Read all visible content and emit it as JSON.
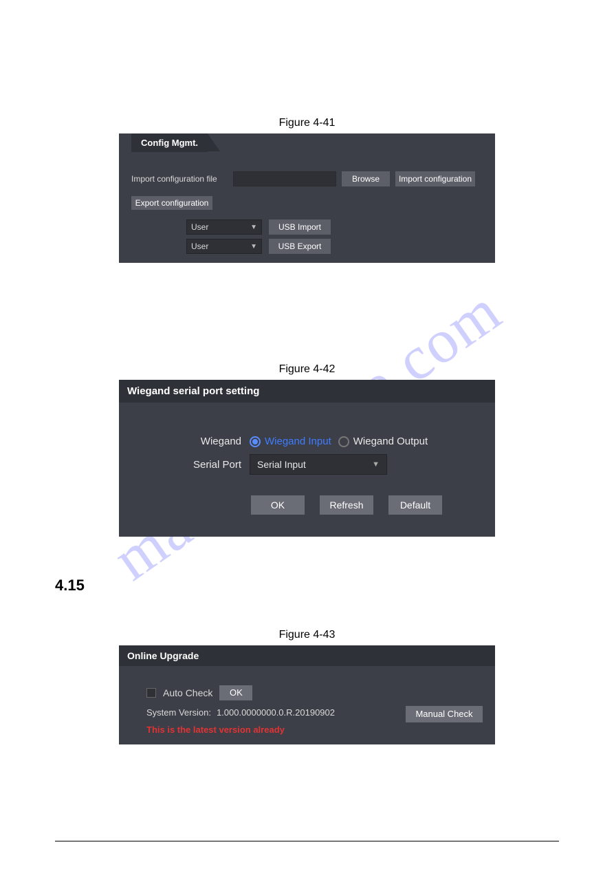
{
  "watermark": "manualshive.com",
  "section_415": "4.15",
  "fig41": {
    "caption": "Figure 4-41",
    "tab_title": "Config Mgmt.",
    "import_label": "Import configuration file",
    "browse_btn": "Browse",
    "import_btn": "Import configuration",
    "export_btn": "Export configuration",
    "select1_value": "User",
    "usb_import_btn": "USB Import",
    "select2_value": "User",
    "usb_export_btn": "USB Export"
  },
  "fig42": {
    "caption": "Figure 4-42",
    "title": "Wiegand serial port setting",
    "wiegand_label": "Wiegand",
    "wiegand_input_label": "Wiegand Input",
    "wiegand_output_label": "Wiegand Output",
    "wiegand_selected": "input",
    "serial_port_label": "Serial Port",
    "serial_port_value": "Serial Input",
    "ok_btn": "OK",
    "refresh_btn": "Refresh",
    "default_btn": "Default"
  },
  "fig43": {
    "caption": "Figure 4-43",
    "title": "Online Upgrade",
    "auto_check_label": "Auto Check",
    "ok_btn": "OK",
    "system_version_label": "System Version:",
    "system_version_value": "1.000.0000000.0.R.20190902",
    "manual_check_btn": "Manual Check",
    "status_text": "This is the latest version already"
  }
}
